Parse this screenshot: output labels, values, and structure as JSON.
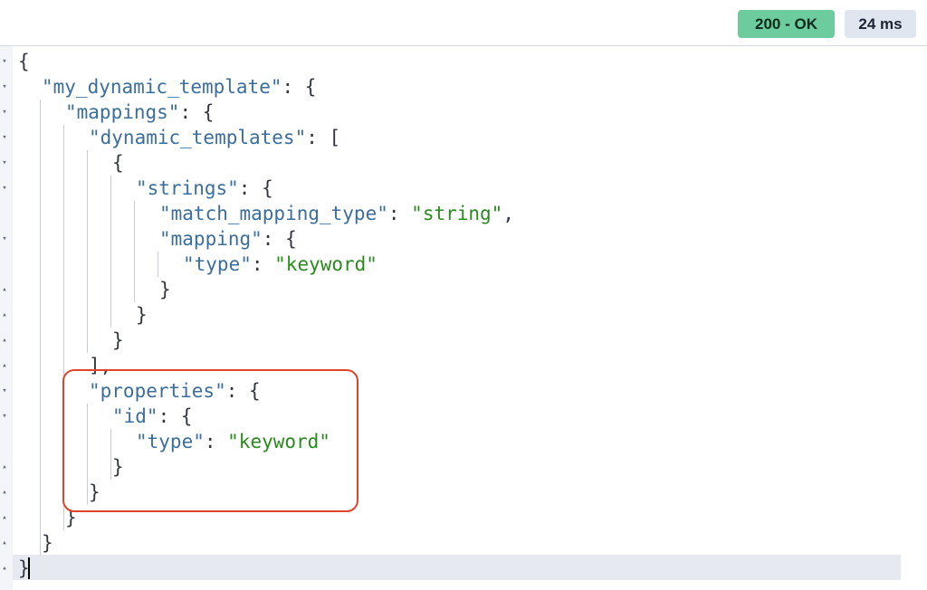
{
  "toolbar": {
    "status_label": "200 - OK",
    "time_label": "24 ms"
  },
  "colors": {
    "status_ok": "#6dcc9e",
    "json_key": "#3b6e9c",
    "json_string": "#2b8a1e",
    "annotation_box": "#e0452b"
  },
  "response_lines": [
    {
      "fold": "open",
      "segments": [
        {
          "t": "p",
          "v": "{"
        }
      ]
    },
    {
      "fold": "open",
      "segments": [
        {
          "t": "k",
          "v": "\"my_dynamic_template\""
        },
        {
          "t": "p",
          "v": ": {"
        }
      ]
    },
    {
      "fold": "open",
      "segments": [
        {
          "t": "k",
          "v": "\"mappings\""
        },
        {
          "t": "p",
          "v": ": {"
        }
      ]
    },
    {
      "fold": "open",
      "segments": [
        {
          "t": "k",
          "v": "\"dynamic_templates\""
        },
        {
          "t": "p",
          "v": ": ["
        }
      ]
    },
    {
      "fold": "open",
      "segments": [
        {
          "t": "p",
          "v": "{"
        }
      ]
    },
    {
      "fold": "open",
      "segments": [
        {
          "t": "k",
          "v": "\"strings\""
        },
        {
          "t": "p",
          "v": ": {"
        }
      ]
    },
    {
      "fold": "none",
      "segments": [
        {
          "t": "k",
          "v": "\"match_mapping_type\""
        },
        {
          "t": "p",
          "v": ": "
        },
        {
          "t": "s",
          "v": "\"string\""
        },
        {
          "t": "p",
          "v": ","
        }
      ]
    },
    {
      "fold": "open",
      "segments": [
        {
          "t": "k",
          "v": "\"mapping\""
        },
        {
          "t": "p",
          "v": ": {"
        }
      ]
    },
    {
      "fold": "none",
      "segments": [
        {
          "t": "k",
          "v": "\"type\""
        },
        {
          "t": "p",
          "v": ": "
        },
        {
          "t": "s",
          "v": "\"keyword\""
        }
      ]
    },
    {
      "fold": "close",
      "segments": [
        {
          "t": "p",
          "v": "}"
        }
      ]
    },
    {
      "fold": "close",
      "segments": [
        {
          "t": "p",
          "v": "}"
        }
      ]
    },
    {
      "fold": "close",
      "segments": [
        {
          "t": "p",
          "v": "}"
        }
      ]
    },
    {
      "fold": "close",
      "segments": [
        {
          "t": "p",
          "v": "],"
        }
      ]
    },
    {
      "fold": "open",
      "segments": [
        {
          "t": "k",
          "v": "\"properties\""
        },
        {
          "t": "p",
          "v": ": {"
        }
      ]
    },
    {
      "fold": "open",
      "segments": [
        {
          "t": "k",
          "v": "\"id\""
        },
        {
          "t": "p",
          "v": ": {"
        }
      ]
    },
    {
      "fold": "none",
      "segments": [
        {
          "t": "k",
          "v": "\"type\""
        },
        {
          "t": "p",
          "v": ": "
        },
        {
          "t": "s",
          "v": "\"keyword\""
        }
      ]
    },
    {
      "fold": "close",
      "segments": [
        {
          "t": "p",
          "v": "}"
        }
      ]
    },
    {
      "fold": "close",
      "segments": [
        {
          "t": "p",
          "v": "}"
        }
      ]
    },
    {
      "fold": "close",
      "segments": [
        {
          "t": "p",
          "v": "}"
        }
      ]
    },
    {
      "fold": "close",
      "segments": [
        {
          "t": "p",
          "v": "}"
        }
      ]
    },
    {
      "fold": "close",
      "segments": [
        {
          "t": "p",
          "v": "}"
        }
      ]
    }
  ]
}
